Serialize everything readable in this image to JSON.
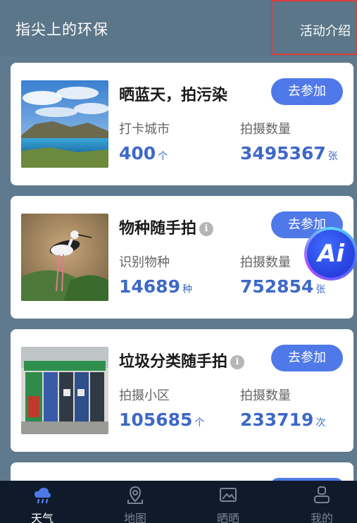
{
  "header": {
    "title": "指尖上的环保",
    "link": "活动介绍"
  },
  "cards": [
    {
      "title": "晒蓝天，拍污染",
      "button": "去参加",
      "stats": [
        {
          "label": "打卡城市",
          "value": "400",
          "unit": "个"
        },
        {
          "label": "拍摄数量",
          "value": "3495367",
          "unit": "张"
        }
      ]
    },
    {
      "title": "物种随手拍",
      "button": "去参加",
      "stats": [
        {
          "label": "识别物种",
          "value": "14689",
          "unit": "种"
        },
        {
          "label": "拍摄数量",
          "value": "752854",
          "unit": "张"
        }
      ]
    },
    {
      "title": "垃圾分类随手拍",
      "button": "去参加",
      "stats": [
        {
          "label": "拍摄小区",
          "value": "105685",
          "unit": "个"
        },
        {
          "label": "拍摄数量",
          "value": "233719",
          "unit": "次"
        }
      ]
    }
  ],
  "ai_badge": "Ai",
  "tabs": [
    {
      "label": "天气",
      "icon": "cloud-rain-icon",
      "active": true
    },
    {
      "label": "地图",
      "icon": "map-pin-icon",
      "active": false
    },
    {
      "label": "晒晒",
      "icon": "photo-icon",
      "active": false
    },
    {
      "label": "我的",
      "icon": "user-icon",
      "active": false
    }
  ],
  "colors": {
    "header_bg": "#5b7688",
    "accent": "#4f79e8",
    "stat_value": "#3d68c9",
    "tabbar_bg": "#0f1a2b",
    "highlight": "#e03a3a"
  }
}
